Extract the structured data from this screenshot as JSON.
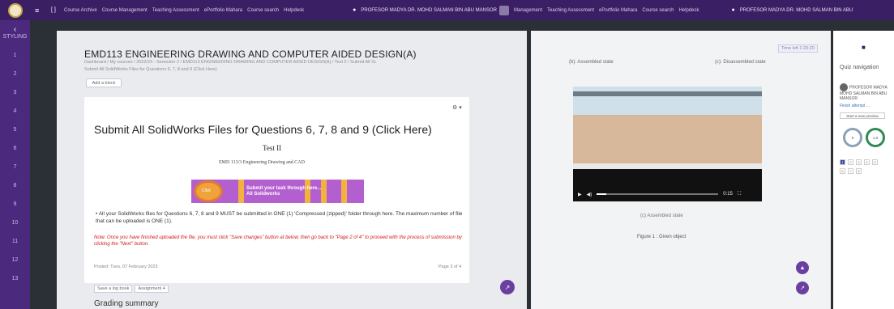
{
  "topbar": {
    "links": [
      "Course Archive",
      "Course Management",
      "Teaching Assessment",
      "ePortfolio Mahara",
      "Course search",
      "Helpdesk"
    ],
    "user": "PROFESOR MADYA DR. MOHD SALMAN BIN ABU MANSOR",
    "links2": [
      "Management",
      "Teaching Assessment",
      "ePortfolio Mahara",
      "Course search",
      "Helpdesk"
    ],
    "user2": "PROFESOR MADYA DR. MOHD SALMAN BIN ABU"
  },
  "sidebar": {
    "label": "STYLING",
    "items": [
      "1",
      "2",
      "3",
      "4",
      "5",
      "6",
      "7",
      "8",
      "9",
      "10",
      "11",
      "12",
      "13"
    ]
  },
  "course": {
    "title": "EMD113 ENGINEERING DRAWING AND COMPUTER AIDED DESIGN(A)",
    "breadcrumb": "Dashboard / My courses / 2022/23 - Semester 2 / EMD113 ENGINEERING DRAWING AND COMPUTER AIDED DESIGN(A) / Test 2 / Submit All SolidWorks Files for Questions 6, 7, 8 and 9 (Click Here) / Tuesday, 7 February",
    "subcrumb": "Submit All SolidWorks Files for Questions 6, 7, 8 and 9 (Click Here)",
    "add_block": "Add a block"
  },
  "card": {
    "title": "Submit All SolidWorks Files for Questions 6, 7, 8 and 9 (Click Here)",
    "test_title": "Test II",
    "test_sub": "EMD 113/3 Engineering Drawing and CAD",
    "banner_orb": "Click",
    "banner_text_1": "Submit your task through here...",
    "banner_text_2": "All Solidworks",
    "bullet": "• All your SolidWorks files for Questions 6, 7, 8 and 9 MUST be submitted in ONE (1) 'Compressed (zipped)' folder through here. The maximum number of file that can be uploaded is ONE (1).",
    "note": "Note: Once you have finished uploaded the file, you must click \"Save changes\" button at below, then go back to \"Page 2 of 4\" to proceed with the process of submission by clicking the \"Next\" button.",
    "posted": "Posted: Tues, 07 February 2023",
    "page_info": "Page 3 of 4",
    "tags": [
      "Save a log book",
      "Assignment 4"
    ],
    "grading": "Grading summary"
  },
  "right": {
    "label1": "(b): Assembled state",
    "label2": "(c): Disassembled state",
    "tab_badge": "Time left 1:23:20",
    "caption1": "(c) Assembled state",
    "caption2": "Figure 1 : Given object",
    "video_time": "0:15",
    "video_progress": 0.08
  },
  "qnav": {
    "title": "Quiz navigation",
    "user_name": "PROFESOR MADYA",
    "user_sub": "MOHD SALMAN BIN ABU MANSOR",
    "link": "Finish attempt ...",
    "btn": "Start a new preview",
    "ring1": "0",
    "ring2": "1.0",
    "numbers": [
      "1",
      "2",
      "3",
      "4",
      "5",
      "6",
      "7",
      "8"
    ]
  },
  "colors": {
    "brand": "#4b2a7d",
    "accent": "#6b3fa0",
    "danger": "#d21b1b"
  }
}
